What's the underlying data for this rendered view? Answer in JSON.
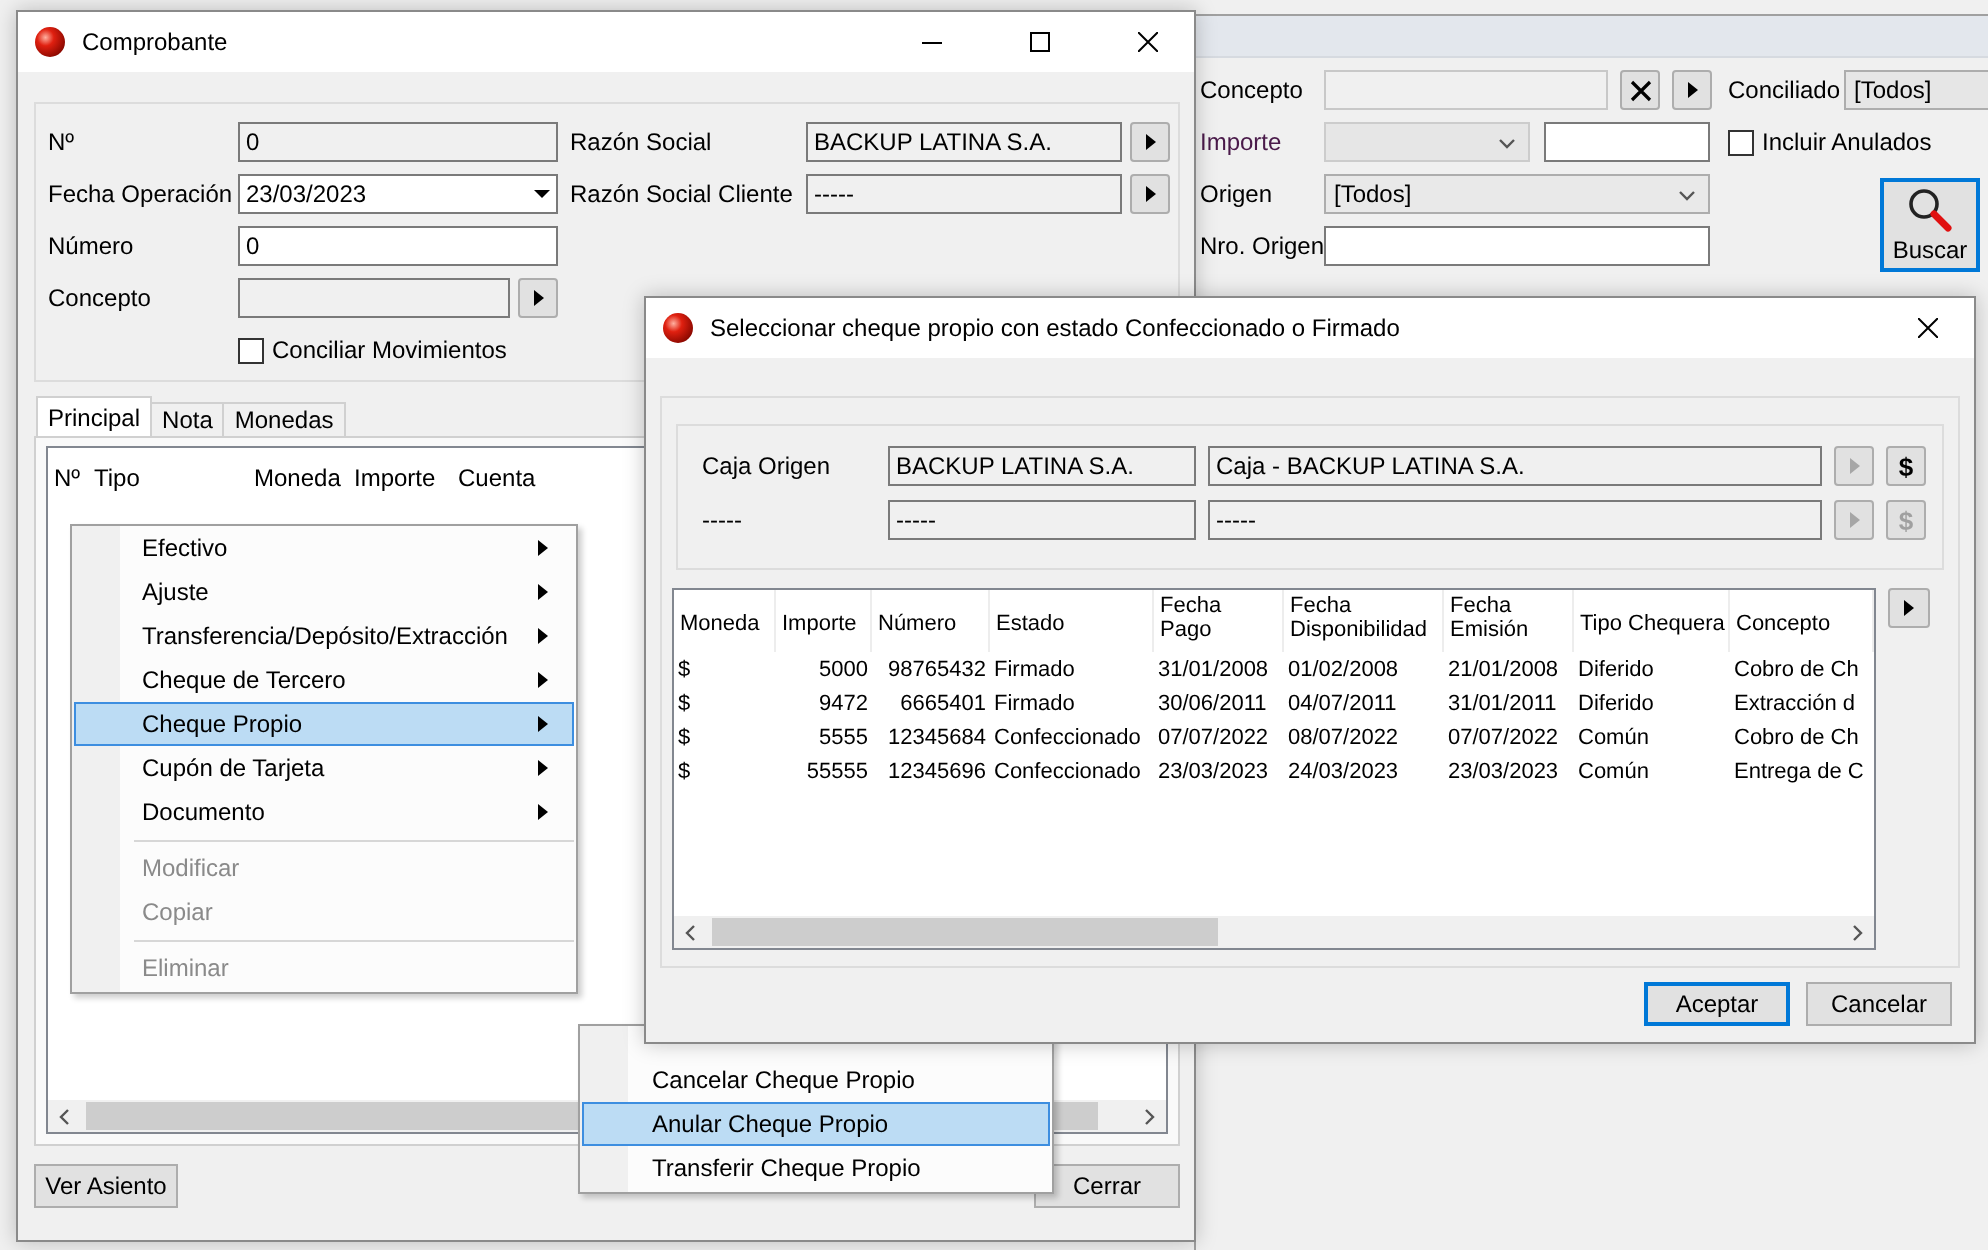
{
  "search_panel": {
    "concepto_label": "Concepto",
    "conciliado": {
      "label": "Conciliado",
      "value": "[Todos]"
    },
    "importe": {
      "label": "Importe",
      "disabled": true
    },
    "incluir_anulados": {
      "label": "Incluir Anulados",
      "checked": false
    },
    "origen": {
      "label": "Origen",
      "value": "[Todos]"
    },
    "nro_origen_label": "Nro. Origen",
    "search_button": "Buscar"
  },
  "comprobante": {
    "title": "Comprobante",
    "left_fields": [
      {
        "label": "Nº",
        "kind": "readonly",
        "value": "0"
      },
      {
        "label": "Fecha Operación",
        "kind": "date",
        "value": "23/03/2023"
      },
      {
        "label": "Número",
        "kind": "text",
        "value": "0"
      },
      {
        "label": "Concepto",
        "kind": "lookup"
      }
    ],
    "right_fields": [
      {
        "label": "Razón Social",
        "kind": "lookup",
        "value": "BACKUP LATINA S.A."
      },
      {
        "label": "Razón Social Cliente",
        "kind": "lookup",
        "value": "-----"
      }
    ],
    "conciliar": {
      "label": "Conciliar Movimientos",
      "checked": false
    },
    "tabs": [
      {
        "label": "Principal",
        "selected": true
      },
      {
        "label": "Nota",
        "selected": false
      },
      {
        "label": "Monedas",
        "selected": false
      }
    ],
    "grid_columns": [
      "Nº",
      "Tipo",
      "Moneda",
      "Importe",
      "Cuenta"
    ],
    "ver_asiento": "Ver Asiento",
    "close_button": "Cerrar"
  },
  "context_menu": {
    "items": [
      {
        "kind": "submenu",
        "label": "Efectivo",
        "selected": false,
        "disabled": false
      },
      {
        "kind": "submenu",
        "label": "Ajuste",
        "selected": false,
        "disabled": false
      },
      {
        "kind": "submenu",
        "label": "Transferencia/Depósito/Extracción",
        "selected": false,
        "disabled": false
      },
      {
        "kind": "submenu",
        "label": "Cheque de Tercero",
        "selected": false,
        "disabled": false
      },
      {
        "kind": "submenu",
        "label": "Cheque Propio",
        "selected": true,
        "disabled": false
      },
      {
        "kind": "submenu",
        "label": "Cupón de Tarjeta",
        "selected": false,
        "disabled": false
      },
      {
        "kind": "submenu",
        "label": "Documento",
        "selected": false,
        "disabled": false
      },
      {
        "kind": "separator"
      },
      {
        "kind": "command",
        "label": "Modificar",
        "selected": false,
        "disabled": true
      },
      {
        "kind": "command",
        "label": "Copiar",
        "selected": false,
        "disabled": true
      },
      {
        "kind": "separator"
      },
      {
        "kind": "command",
        "label": "Eliminar",
        "selected": false,
        "disabled": true
      }
    ]
  },
  "submenu": {
    "items": [
      {
        "label": "Cancelar Cheque Propio",
        "selected": false
      },
      {
        "label": "Anular Cheque Propio",
        "selected": true
      },
      {
        "label": "Transferir Cheque Propio",
        "selected": false
      }
    ]
  },
  "dialog": {
    "title": "Seleccionar cheque propio con estado Confeccionado o Firmado",
    "rows": [
      {
        "label": "Caja Origen",
        "company": "BACKUP LATINA S.A.",
        "account": "Caja - BACKUP LATINA S.A.",
        "lookup_enabled": false,
        "currency_button": "$",
        "currency_enabled": true
      },
      {
        "label": "-----",
        "company": "-----",
        "account": "-----",
        "lookup_enabled": false,
        "currency_button": "$",
        "currency_enabled": false
      }
    ],
    "table": {
      "columns": [
        {
          "label": "Moneda",
          "wrap": false
        },
        {
          "label": "Importe",
          "wrap": false
        },
        {
          "label": "Número",
          "wrap": false
        },
        {
          "label": "Estado",
          "wrap": false
        },
        {
          "label": "Fecha Pago",
          "wrap": true
        },
        {
          "label": "Fecha Disponibilidad",
          "wrap": true
        },
        {
          "label": "Fecha Emisión",
          "wrap": true
        },
        {
          "label": "Tipo Chequera",
          "wrap": false
        },
        {
          "label": "Concepto",
          "wrap": false
        }
      ],
      "rows": [
        [
          "$",
          "5000",
          "98765432",
          "Firmado",
          "31/01/2008",
          "01/02/2008",
          "21/01/2008",
          "Diferido",
          "Cobro de Ch"
        ],
        [
          "$",
          "9472",
          "6665401",
          "Firmado",
          "30/06/2011",
          "04/07/2011",
          "31/01/2011",
          "Diferido",
          "Extracción d"
        ],
        [
          "$",
          "5555",
          "12345684",
          "Confeccionado",
          "07/07/2022",
          "08/07/2022",
          "07/07/2022",
          "Común",
          "Cobro de Ch"
        ],
        [
          "$",
          "55555",
          "12345696",
          "Confeccionado",
          "23/03/2023",
          "24/03/2023",
          "23/03/2023",
          "Común",
          "Entrega de C"
        ]
      ]
    },
    "buttons": [
      {
        "label": "Aceptar",
        "default": true
      },
      {
        "label": "Cancelar",
        "default": false
      }
    ]
  }
}
